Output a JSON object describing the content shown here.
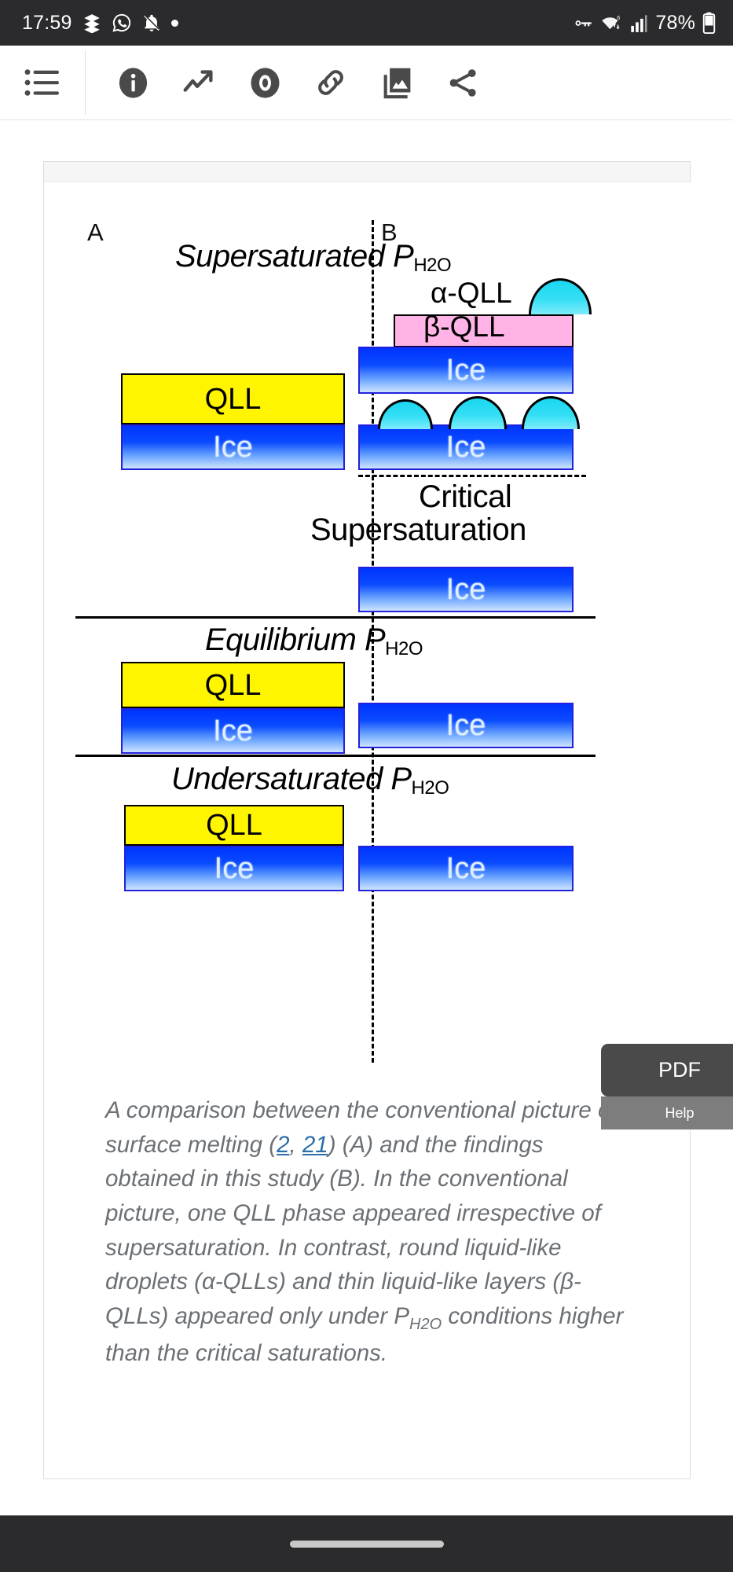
{
  "status_bar": {
    "time": "17:59",
    "battery_percent": "78%",
    "left_icons": [
      "app-badge-icon",
      "whatsapp-icon",
      "bell-muted-icon",
      "dot-icon"
    ],
    "right_icons": [
      "vpn-key-icon",
      "wifi-6-icon",
      "signal-bars-icon",
      "battery-icon"
    ]
  },
  "toolbar": {
    "menu_label": "",
    "items": [
      {
        "name": "info-icon",
        "label": ""
      },
      {
        "name": "metrics-trending-icon",
        "label": ""
      },
      {
        "name": "eye-view-icon",
        "label": ""
      },
      {
        "name": "link-icon",
        "label": ""
      },
      {
        "name": "figures-gallery-icon",
        "label": ""
      },
      {
        "name": "share-icon",
        "label": ""
      }
    ]
  },
  "figure": {
    "panel_a_label": "A",
    "panel_b_label": "B",
    "headings": {
      "supersaturated": "Supersaturated P",
      "supersaturated_sub": "H2O",
      "critical_line1": "Critical",
      "critical_line2": "Supersaturation",
      "equilibrium": "Equilibrium P",
      "equilibrium_sub": "H2O",
      "undersaturated": "Undersaturated P",
      "undersaturated_sub": "H2O"
    },
    "callouts": {
      "alpha_qll": "α-QLL",
      "beta_qll": "β-QLL"
    },
    "box_labels": {
      "qll": "QLL",
      "ice": "Ice"
    },
    "colors": {
      "qll_yellow": "#FFF500",
      "beta_pink": "#FFB3E6",
      "ice_blue": "#0033FF",
      "droplet_cyan": "#35DFF5",
      "outline": "#000000"
    }
  },
  "caption": {
    "part1": "A comparison between the conventional picture of surface melting (",
    "ref1": "2",
    "comma": ", ",
    "ref2": "21",
    "part2": ") (A) and the findings obtained in this study (B). In the conventional picture, one QLL phase appeared irrespective of supersaturation. In contrast, round liquid-like droplets (α-QLLs) and thin liquid-like layers (β-QLLs) appeared only under P",
    "sub": "H2O",
    "part3": " conditions higher than the critical saturations."
  },
  "floating": {
    "pdf_label": "PDF",
    "help_label": "Help"
  }
}
